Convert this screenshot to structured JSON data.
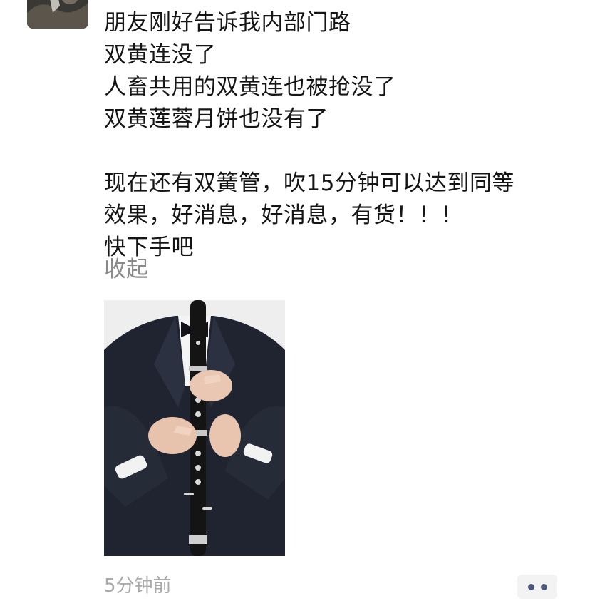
{
  "post": {
    "lines": [
      "朋友刚好告诉我内部门路",
      "双黄连没了",
      "人畜共用的双黄连也被抢没了",
      "双黄莲蓉月饼也没有了",
      "",
      "现在还有双簧管，吹15分钟可以达到同等",
      "效果，好消息，好消息，有货！！！",
      "快下手吧"
    ],
    "collapse_label": "收起",
    "timestamp": "5分钟前"
  },
  "icons": {
    "avatar": "avatar-photo",
    "more": "more-dots-icon"
  },
  "colors": {
    "text": "#151515",
    "link": "#8a8a8a",
    "timestamp": "#aaaaaa",
    "dots": "#4b5a7a"
  }
}
